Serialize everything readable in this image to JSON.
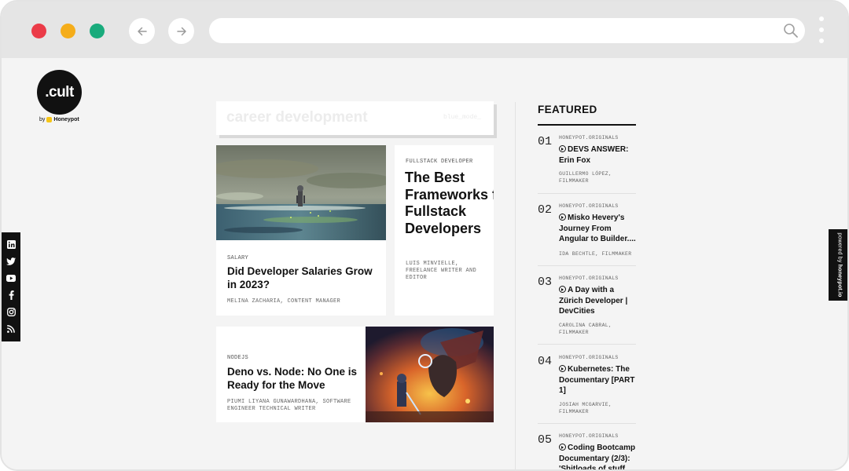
{
  "logo": {
    "text": ".cult",
    "by": "by",
    "brand": "Honeypot"
  },
  "search_tag": {
    "title": "career development",
    "subtitle": "blue_mode_"
  },
  "cards": [
    {
      "category": "SALARY",
      "title": "Did Developer Salaries Grow in 2023?",
      "author": "MELINA ZACHARIA, CONTENT MANAGER"
    },
    {
      "category": "FULLSTACK DEVELOPER",
      "title": "The Best Frameworks for Fullstack Developers",
      "author": "LUIS MINVIELLE, FREELANCE WRITER AND EDITOR"
    },
    {
      "category": "NODEJS",
      "title": "Deno vs. Node: No One is Ready for the Move",
      "author": "PIUMI LIYANA GUNAWARDHANA, SOFTWARE ENGINEER TECHNICAL WRITER"
    }
  ],
  "featured": {
    "heading": "FEATURED",
    "items": [
      {
        "num": "01",
        "source": "HONEYPOT.ORIGINALS",
        "title": "DEVS ANSWER: Erin Fox",
        "author": "GUILLERMO LÓPEZ, FILMMAKER"
      },
      {
        "num": "02",
        "source": "HONEYPOT.ORIGINALS",
        "title": "Misko Hevery's Journey From Angular to Builder....",
        "author": "IDA BECHTLE, FILMMAKER"
      },
      {
        "num": "03",
        "source": "HONEYPOT.ORIGINALS",
        "title": "A Day with a Zürich Developer | DevCities",
        "author": "CAROLINA CABRAL, FILMMAKER"
      },
      {
        "num": "04",
        "source": "HONEYPOT.ORIGINALS",
        "title": "Kubernetes: The Documentary [PART 1]",
        "author": "JOSIAH MCGARVIE, FILMMAKER"
      },
      {
        "num": "05",
        "source": "HONEYPOT.ORIGINALS",
        "title": "Coding Bootcamp Documentary (2/3): 'Shitloads of stuff",
        "author": ""
      }
    ]
  },
  "powered": {
    "prefix": "powered by",
    "brand": "honeypot.io"
  },
  "social_icons": [
    "linkedin-icon",
    "twitter-icon",
    "youtube-icon",
    "facebook-icon",
    "instagram-icon",
    "rss-icon"
  ],
  "colors": {
    "red": "#eb3b48",
    "yellow": "#f5ad1a",
    "green": "#19ab7c",
    "dark": "#111111",
    "background": "#f4f4f4"
  }
}
